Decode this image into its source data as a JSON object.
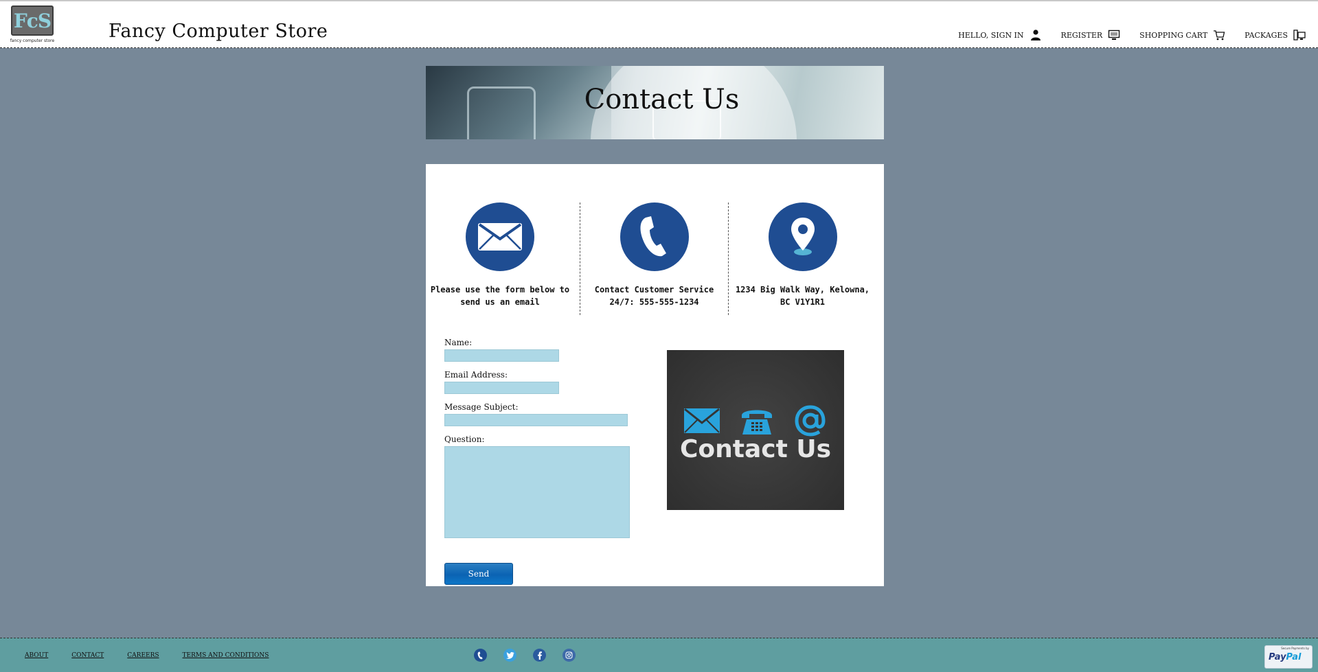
{
  "header": {
    "logo_letters": "FcS",
    "logo_caption": "fancy computer store",
    "site_title": "Fancy Computer Store",
    "nav": [
      {
        "label": "Hello, Sign In",
        "icon": "user-icon"
      },
      {
        "label": "Register",
        "icon": "monitor-icon"
      },
      {
        "label": "Shopping Cart",
        "icon": "cart-icon"
      },
      {
        "label": "Packages",
        "icon": "desktop-tower-icon"
      }
    ]
  },
  "banner": {
    "title": "Contact Us"
  },
  "contact_methods": [
    {
      "icon": "envelope-icon",
      "text": "Please use the form below to send us an email"
    },
    {
      "icon": "phone-icon",
      "text": "Contact Customer Service 24/7: 555-555-1234"
    },
    {
      "icon": "location-pin-icon",
      "text": "1234 Big Walk Way, Kelowna, BC V1Y1R1"
    }
  ],
  "form": {
    "name_label": "Name:",
    "email_label": "Email Address:",
    "subject_label": "Message Subject:",
    "question_label": "Question:",
    "send_label": "Send"
  },
  "contact_image": {
    "text": "Contact Us"
  },
  "footer": {
    "links": [
      "About",
      "Contact",
      "Careers",
      "Terms and Conditions"
    ],
    "social": [
      "phone-icon",
      "twitter-icon",
      "facebook-icon",
      "instagram-icon"
    ],
    "paypal_caption": "Secure Payments by",
    "paypal_word_1": "Pay",
    "paypal_word_2": "Pal"
  },
  "colors": {
    "page_bg": "#778898",
    "accent_blue": "#1f4d92",
    "field_bg": "#add8e6",
    "footer_bg": "#5f9ea0"
  }
}
